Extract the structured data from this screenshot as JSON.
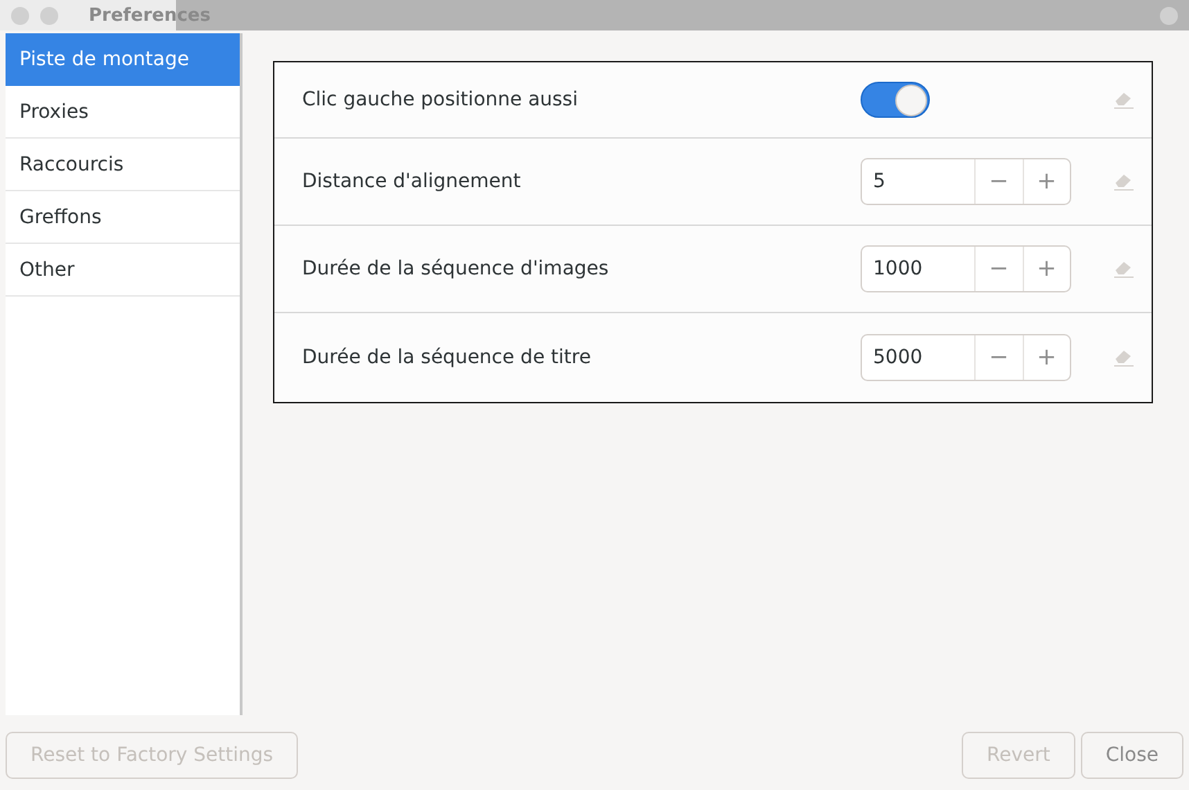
{
  "window": {
    "title": "Preferences"
  },
  "sidebar": {
    "items": [
      {
        "label": "Piste de montage",
        "selected": true
      },
      {
        "label": "Proxies",
        "selected": false
      },
      {
        "label": "Raccourcis",
        "selected": false
      },
      {
        "label": "Greffons",
        "selected": false
      },
      {
        "label": "Other",
        "selected": false
      }
    ]
  },
  "settings": [
    {
      "kind": "toggle",
      "label": "Clic gauche positionne aussi",
      "on": true
    },
    {
      "kind": "spin",
      "label": "Distance d'alignement",
      "value": "5",
      "minus": "−",
      "plus": "+"
    },
    {
      "kind": "spin",
      "label": "Durée de la séquence d'images",
      "value": "1000",
      "minus": "−",
      "plus": "+"
    },
    {
      "kind": "spin",
      "label": "Durée de la séquence de titre",
      "value": "5000",
      "minus": "−",
      "plus": "+"
    }
  ],
  "footer": {
    "left_buttons": [
      {
        "label": "Reset to Factory Settings",
        "disabled": true
      }
    ],
    "right_buttons": [
      {
        "label": "Revert",
        "disabled": true
      },
      {
        "label": "Close",
        "disabled": false
      }
    ]
  }
}
